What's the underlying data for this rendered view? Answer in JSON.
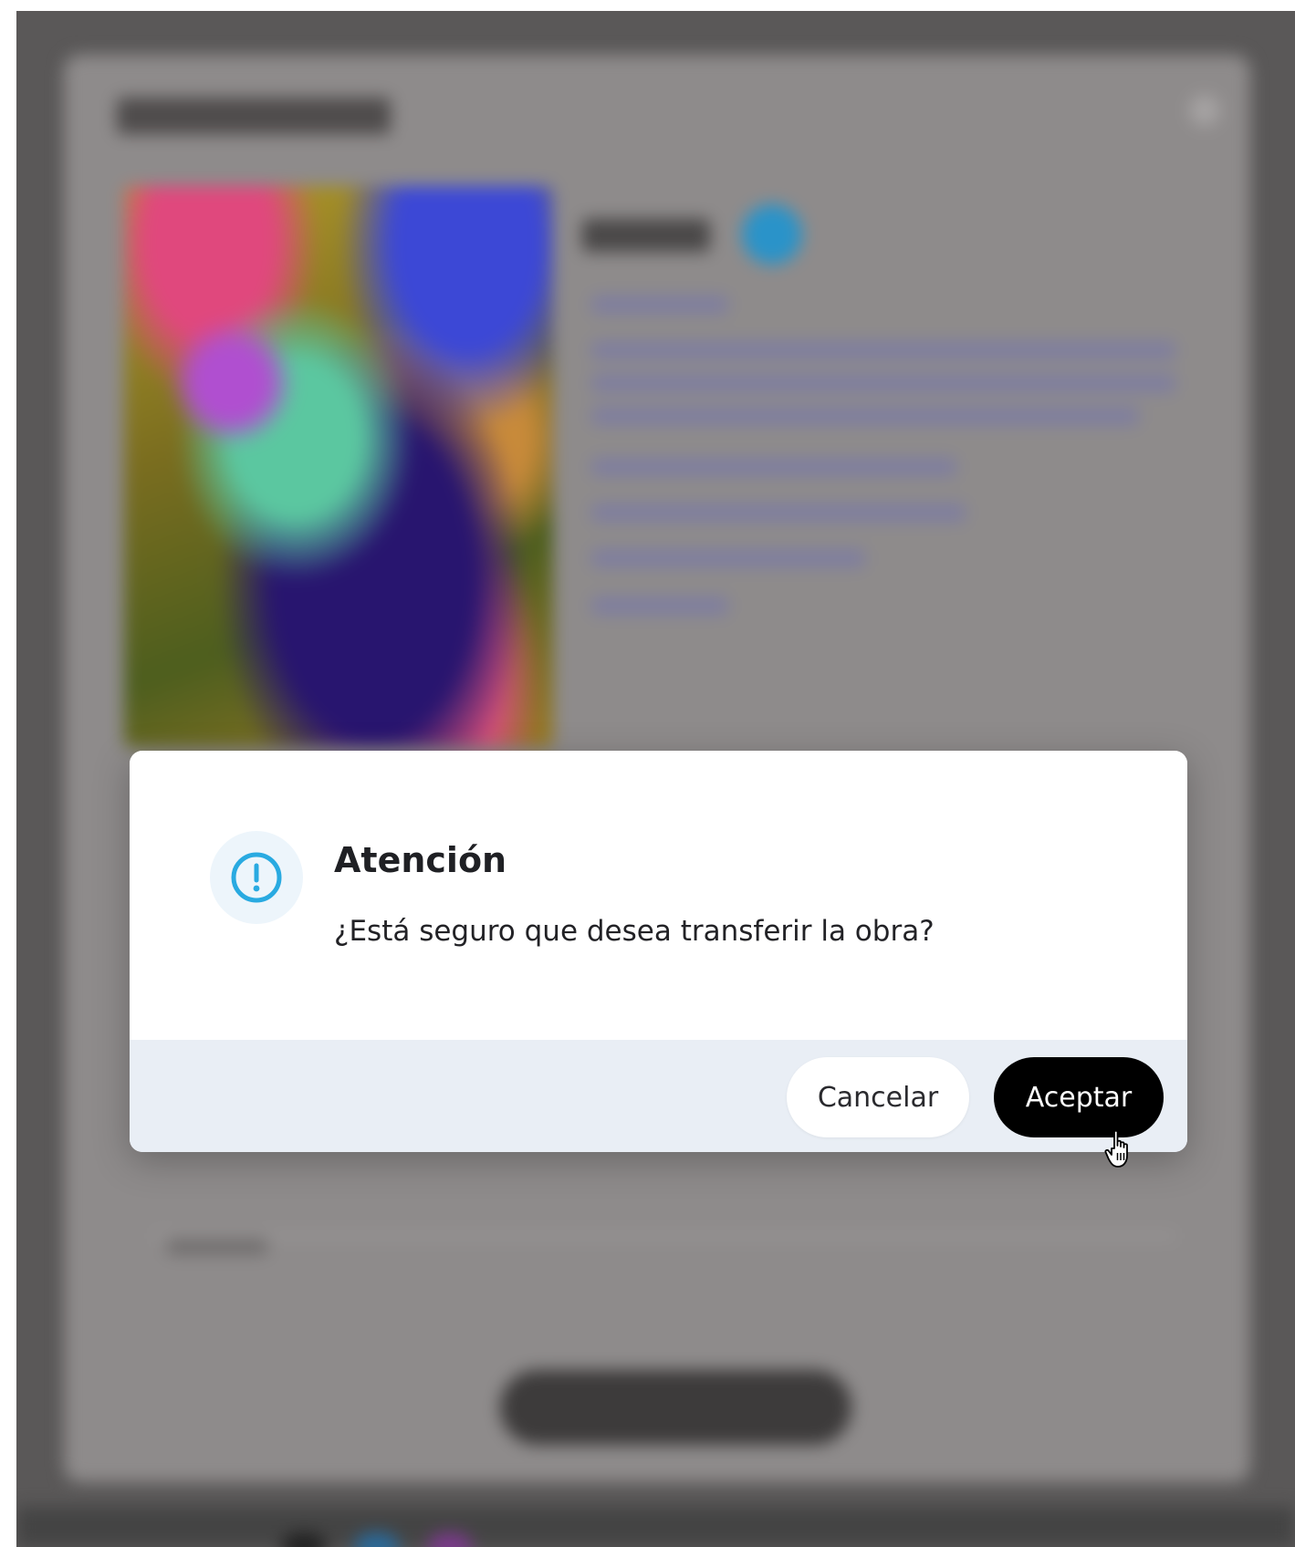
{
  "dialog": {
    "title": "Atención",
    "message": "¿Está seguro que desea transferir la obra?",
    "icon": "exclamation-circle-icon",
    "cancel_label": "Cancelar",
    "accept_label": "Aceptar"
  },
  "colors": {
    "accent": "#29aae1",
    "accept_button": "#000000",
    "footer": "#e9eef5",
    "overlay": "#5a5858"
  }
}
